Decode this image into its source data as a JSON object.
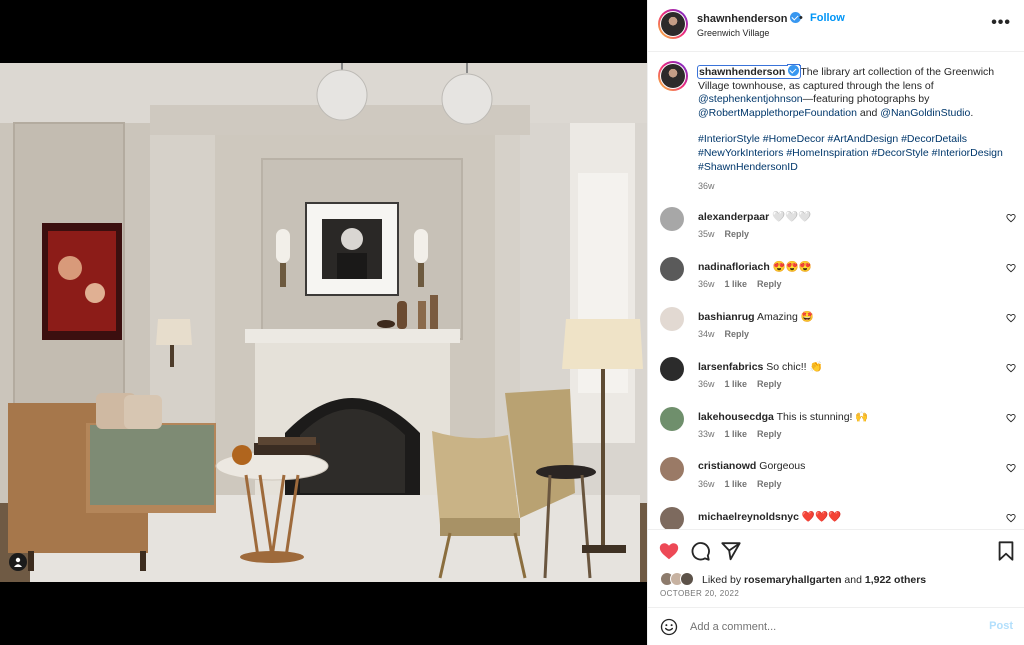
{
  "post": {
    "username": "shawnhenderson",
    "separator": "•",
    "follow_label": "Follow",
    "location": "Greenwich Village",
    "more_icon": "more-options-icon"
  },
  "caption": {
    "username": "shawnhenderson",
    "text_1": "The library art collection of the Greenwich Village townhouse, as captured through the lens of ",
    "mention_1": "@stephenkentjohnson",
    "text_2": "—featuring photographs by ",
    "mention_2": "@RobertMapplethorpeFoundation",
    "text_3": " and ",
    "mention_3": "@NanGoldinStudio",
    "text_4": ".",
    "hashtags": "#InteriorStyle #HomeDecor #ArtAndDesign #DecorDetails #NewYorkInteriors #HomeInspiration #DecorStyle #InteriorDesign #ShawnHendersonID",
    "age": "36w"
  },
  "comments": [
    {
      "user": "alexanderpaar",
      "text": "🤍🤍🤍",
      "age": "35w",
      "likes": "",
      "reply": "Reply",
      "avatar_color": "#a7a7a7"
    },
    {
      "user": "nadinafloriach",
      "text": "😍😍😍",
      "age": "36w",
      "likes": "1 like",
      "reply": "Reply",
      "avatar_color": "#5a5a5a"
    },
    {
      "user": "bashianrug",
      "text": "Amazing 🤩",
      "age": "34w",
      "likes": "",
      "reply": "Reply",
      "avatar_color": "#e2d9d2"
    },
    {
      "user": "larsenfabrics",
      "text": "So chic!! 👏",
      "age": "36w",
      "likes": "1 like",
      "reply": "Reply",
      "avatar_color": "#2b2b2b"
    },
    {
      "user": "lakehousecdga",
      "text": "This is stunning! 🙌",
      "age": "33w",
      "likes": "1 like",
      "reply": "Reply",
      "avatar_color": "#6f8f6c"
    },
    {
      "user": "cristianowd",
      "text": "Gorgeous",
      "age": "36w",
      "likes": "1 like",
      "reply": "Reply",
      "avatar_color": "#9a7a66"
    },
    {
      "user": "michaelreynoldsnyc",
      "text": "❤️❤️❤️",
      "age": "",
      "likes": "",
      "reply": "",
      "avatar_color": "#7d6a5e"
    }
  ],
  "actions": {
    "like_icon": "heart-filled-icon",
    "comment_icon": "comment-icon",
    "share_icon": "share-icon",
    "save_icon": "bookmark-icon",
    "liked_prefix": "Liked by ",
    "liked_user": "rosemaryhallgarten",
    "liked_mid": " and ",
    "liked_count": "1,922 others",
    "date": "OCTOBER 20, 2022"
  },
  "composer": {
    "placeholder": "Add a comment...",
    "post_label": "Post",
    "emoji_icon": "emoji-icon"
  },
  "colors": {
    "accent": "#0095f6",
    "heart": "#ed4956",
    "link": "#00376b"
  }
}
